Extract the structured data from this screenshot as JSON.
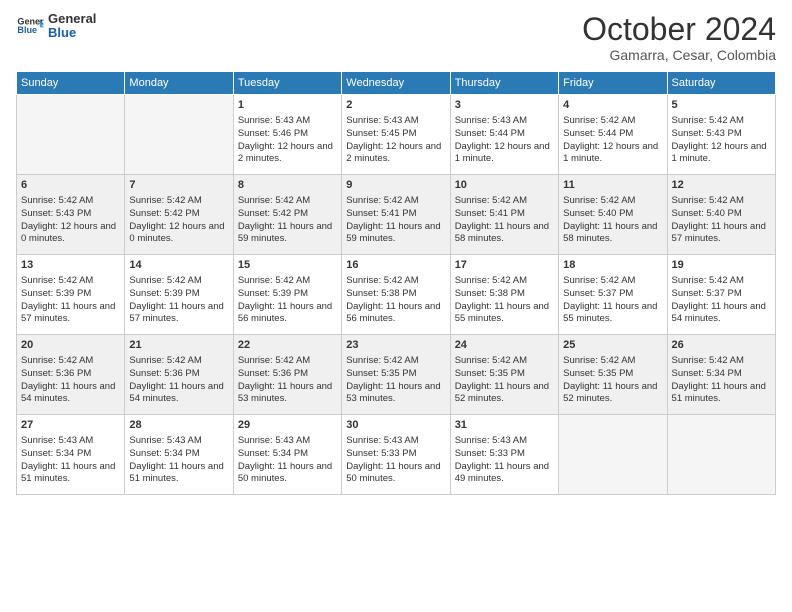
{
  "logo": {
    "line1": "General",
    "line2": "Blue"
  },
  "title": "October 2024",
  "location": "Gamarra, Cesar, Colombia",
  "days_of_week": [
    "Sunday",
    "Monday",
    "Tuesday",
    "Wednesday",
    "Thursday",
    "Friday",
    "Saturday"
  ],
  "weeks": [
    [
      {
        "day": "",
        "empty": true
      },
      {
        "day": "",
        "empty": true
      },
      {
        "day": "1",
        "sunrise": "Sunrise: 5:43 AM",
        "sunset": "Sunset: 5:46 PM",
        "daylight": "Daylight: 12 hours and 2 minutes."
      },
      {
        "day": "2",
        "sunrise": "Sunrise: 5:43 AM",
        "sunset": "Sunset: 5:45 PM",
        "daylight": "Daylight: 12 hours and 2 minutes."
      },
      {
        "day": "3",
        "sunrise": "Sunrise: 5:43 AM",
        "sunset": "Sunset: 5:44 PM",
        "daylight": "Daylight: 12 hours and 1 minute."
      },
      {
        "day": "4",
        "sunrise": "Sunrise: 5:42 AM",
        "sunset": "Sunset: 5:44 PM",
        "daylight": "Daylight: 12 hours and 1 minute."
      },
      {
        "day": "5",
        "sunrise": "Sunrise: 5:42 AM",
        "sunset": "Sunset: 5:43 PM",
        "daylight": "Daylight: 12 hours and 1 minute."
      }
    ],
    [
      {
        "day": "6",
        "sunrise": "Sunrise: 5:42 AM",
        "sunset": "Sunset: 5:43 PM",
        "daylight": "Daylight: 12 hours and 0 minutes."
      },
      {
        "day": "7",
        "sunrise": "Sunrise: 5:42 AM",
        "sunset": "Sunset: 5:42 PM",
        "daylight": "Daylight: 12 hours and 0 minutes."
      },
      {
        "day": "8",
        "sunrise": "Sunrise: 5:42 AM",
        "sunset": "Sunset: 5:42 PM",
        "daylight": "Daylight: 11 hours and 59 minutes."
      },
      {
        "day": "9",
        "sunrise": "Sunrise: 5:42 AM",
        "sunset": "Sunset: 5:41 PM",
        "daylight": "Daylight: 11 hours and 59 minutes."
      },
      {
        "day": "10",
        "sunrise": "Sunrise: 5:42 AM",
        "sunset": "Sunset: 5:41 PM",
        "daylight": "Daylight: 11 hours and 58 minutes."
      },
      {
        "day": "11",
        "sunrise": "Sunrise: 5:42 AM",
        "sunset": "Sunset: 5:40 PM",
        "daylight": "Daylight: 11 hours and 58 minutes."
      },
      {
        "day": "12",
        "sunrise": "Sunrise: 5:42 AM",
        "sunset": "Sunset: 5:40 PM",
        "daylight": "Daylight: 11 hours and 57 minutes."
      }
    ],
    [
      {
        "day": "13",
        "sunrise": "Sunrise: 5:42 AM",
        "sunset": "Sunset: 5:39 PM",
        "daylight": "Daylight: 11 hours and 57 minutes."
      },
      {
        "day": "14",
        "sunrise": "Sunrise: 5:42 AM",
        "sunset": "Sunset: 5:39 PM",
        "daylight": "Daylight: 11 hours and 57 minutes."
      },
      {
        "day": "15",
        "sunrise": "Sunrise: 5:42 AM",
        "sunset": "Sunset: 5:39 PM",
        "daylight": "Daylight: 11 hours and 56 minutes."
      },
      {
        "day": "16",
        "sunrise": "Sunrise: 5:42 AM",
        "sunset": "Sunset: 5:38 PM",
        "daylight": "Daylight: 11 hours and 56 minutes."
      },
      {
        "day": "17",
        "sunrise": "Sunrise: 5:42 AM",
        "sunset": "Sunset: 5:38 PM",
        "daylight": "Daylight: 11 hours and 55 minutes."
      },
      {
        "day": "18",
        "sunrise": "Sunrise: 5:42 AM",
        "sunset": "Sunset: 5:37 PM",
        "daylight": "Daylight: 11 hours and 55 minutes."
      },
      {
        "day": "19",
        "sunrise": "Sunrise: 5:42 AM",
        "sunset": "Sunset: 5:37 PM",
        "daylight": "Daylight: 11 hours and 54 minutes."
      }
    ],
    [
      {
        "day": "20",
        "sunrise": "Sunrise: 5:42 AM",
        "sunset": "Sunset: 5:36 PM",
        "daylight": "Daylight: 11 hours and 54 minutes."
      },
      {
        "day": "21",
        "sunrise": "Sunrise: 5:42 AM",
        "sunset": "Sunset: 5:36 PM",
        "daylight": "Daylight: 11 hours and 54 minutes."
      },
      {
        "day": "22",
        "sunrise": "Sunrise: 5:42 AM",
        "sunset": "Sunset: 5:36 PM",
        "daylight": "Daylight: 11 hours and 53 minutes."
      },
      {
        "day": "23",
        "sunrise": "Sunrise: 5:42 AM",
        "sunset": "Sunset: 5:35 PM",
        "daylight": "Daylight: 11 hours and 53 minutes."
      },
      {
        "day": "24",
        "sunrise": "Sunrise: 5:42 AM",
        "sunset": "Sunset: 5:35 PM",
        "daylight": "Daylight: 11 hours and 52 minutes."
      },
      {
        "day": "25",
        "sunrise": "Sunrise: 5:42 AM",
        "sunset": "Sunset: 5:35 PM",
        "daylight": "Daylight: 11 hours and 52 minutes."
      },
      {
        "day": "26",
        "sunrise": "Sunrise: 5:42 AM",
        "sunset": "Sunset: 5:34 PM",
        "daylight": "Daylight: 11 hours and 51 minutes."
      }
    ],
    [
      {
        "day": "27",
        "sunrise": "Sunrise: 5:43 AM",
        "sunset": "Sunset: 5:34 PM",
        "daylight": "Daylight: 11 hours and 51 minutes."
      },
      {
        "day": "28",
        "sunrise": "Sunrise: 5:43 AM",
        "sunset": "Sunset: 5:34 PM",
        "daylight": "Daylight: 11 hours and 51 minutes."
      },
      {
        "day": "29",
        "sunrise": "Sunrise: 5:43 AM",
        "sunset": "Sunset: 5:34 PM",
        "daylight": "Daylight: 11 hours and 50 minutes."
      },
      {
        "day": "30",
        "sunrise": "Sunrise: 5:43 AM",
        "sunset": "Sunset: 5:33 PM",
        "daylight": "Daylight: 11 hours and 50 minutes."
      },
      {
        "day": "31",
        "sunrise": "Sunrise: 5:43 AM",
        "sunset": "Sunset: 5:33 PM",
        "daylight": "Daylight: 11 hours and 49 minutes."
      },
      {
        "day": "",
        "empty": true
      },
      {
        "day": "",
        "empty": true
      }
    ]
  ],
  "colors": {
    "header_bg": "#2a7ab5",
    "shaded_row": "#f0f0f0",
    "white_row": "#ffffff"
  }
}
